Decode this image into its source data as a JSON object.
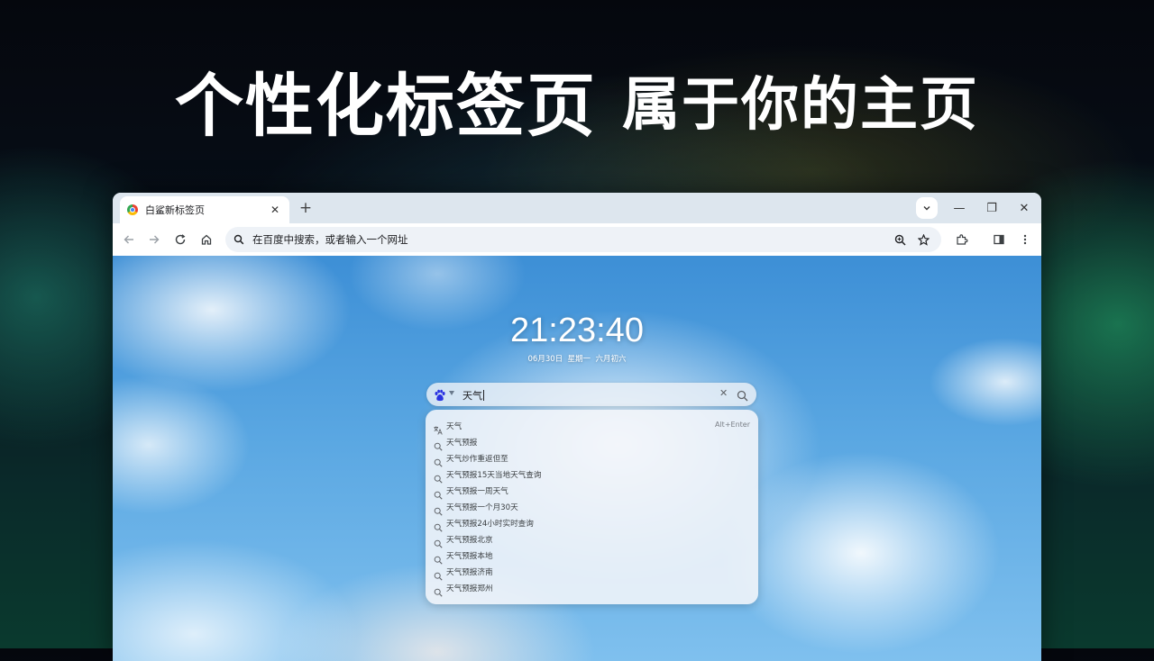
{
  "banner": {
    "headline": "个性化标签页",
    "subheadline": "属于你的主页"
  },
  "browser": {
    "tab": {
      "title": "白鲨新标签页",
      "favicon": "chrome-icon",
      "close_glyph": "✕"
    },
    "new_tab_glyph": "+",
    "window_controls": {
      "minimize": "—",
      "restore": "❐",
      "close": "✕"
    },
    "toolbar": {
      "back_icon": "arrow-left-icon",
      "forward_icon": "arrow-right-icon",
      "reload_icon": "reload-icon",
      "home_icon": "home-icon",
      "omnibox_placeholder": "在百度中搜索，或者输入一个网址",
      "zoom_icon": "zoom-icon",
      "bookmark_icon": "star-icon",
      "extensions_icon": "puzzle-icon",
      "side_panel_icon": "side-panel-icon",
      "menu_icon": "kebab-menu-icon"
    }
  },
  "newtab": {
    "clock": "21:23:40",
    "date": "06月30日  星期一  六月初六",
    "search": {
      "engine_icon": "baidu-paw-icon",
      "query": "天气",
      "clear_glyph": "✕",
      "search_icon": "search-icon"
    },
    "suggestions": [
      {
        "text": "天气",
        "icon": "translate-icon",
        "hint": "Alt+Enter"
      },
      {
        "text": "天气预报",
        "icon": "search-icon"
      },
      {
        "text": "天气炒作重返但至",
        "icon": "search-icon"
      },
      {
        "text": "天气预报15天当地天气查询",
        "icon": "search-icon"
      },
      {
        "text": "天气预报一周天气",
        "icon": "search-icon"
      },
      {
        "text": "天气预报一个月30天",
        "icon": "search-icon"
      },
      {
        "text": "天气预报24小时实时查询",
        "icon": "search-icon"
      },
      {
        "text": "天气预报北京",
        "icon": "search-icon"
      },
      {
        "text": "天气预报本地",
        "icon": "search-icon"
      },
      {
        "text": "天气预报济南",
        "icon": "search-icon"
      },
      {
        "text": "天气预报郑州",
        "icon": "search-icon"
      }
    ]
  },
  "colors": {
    "headline_text": "#ffffff",
    "tabstrip_bg": "#dde6ee",
    "omnibox_bg": "#eef2f7",
    "baidu_blue": "#2932e1",
    "sky_blue": "#5aa7e2"
  }
}
